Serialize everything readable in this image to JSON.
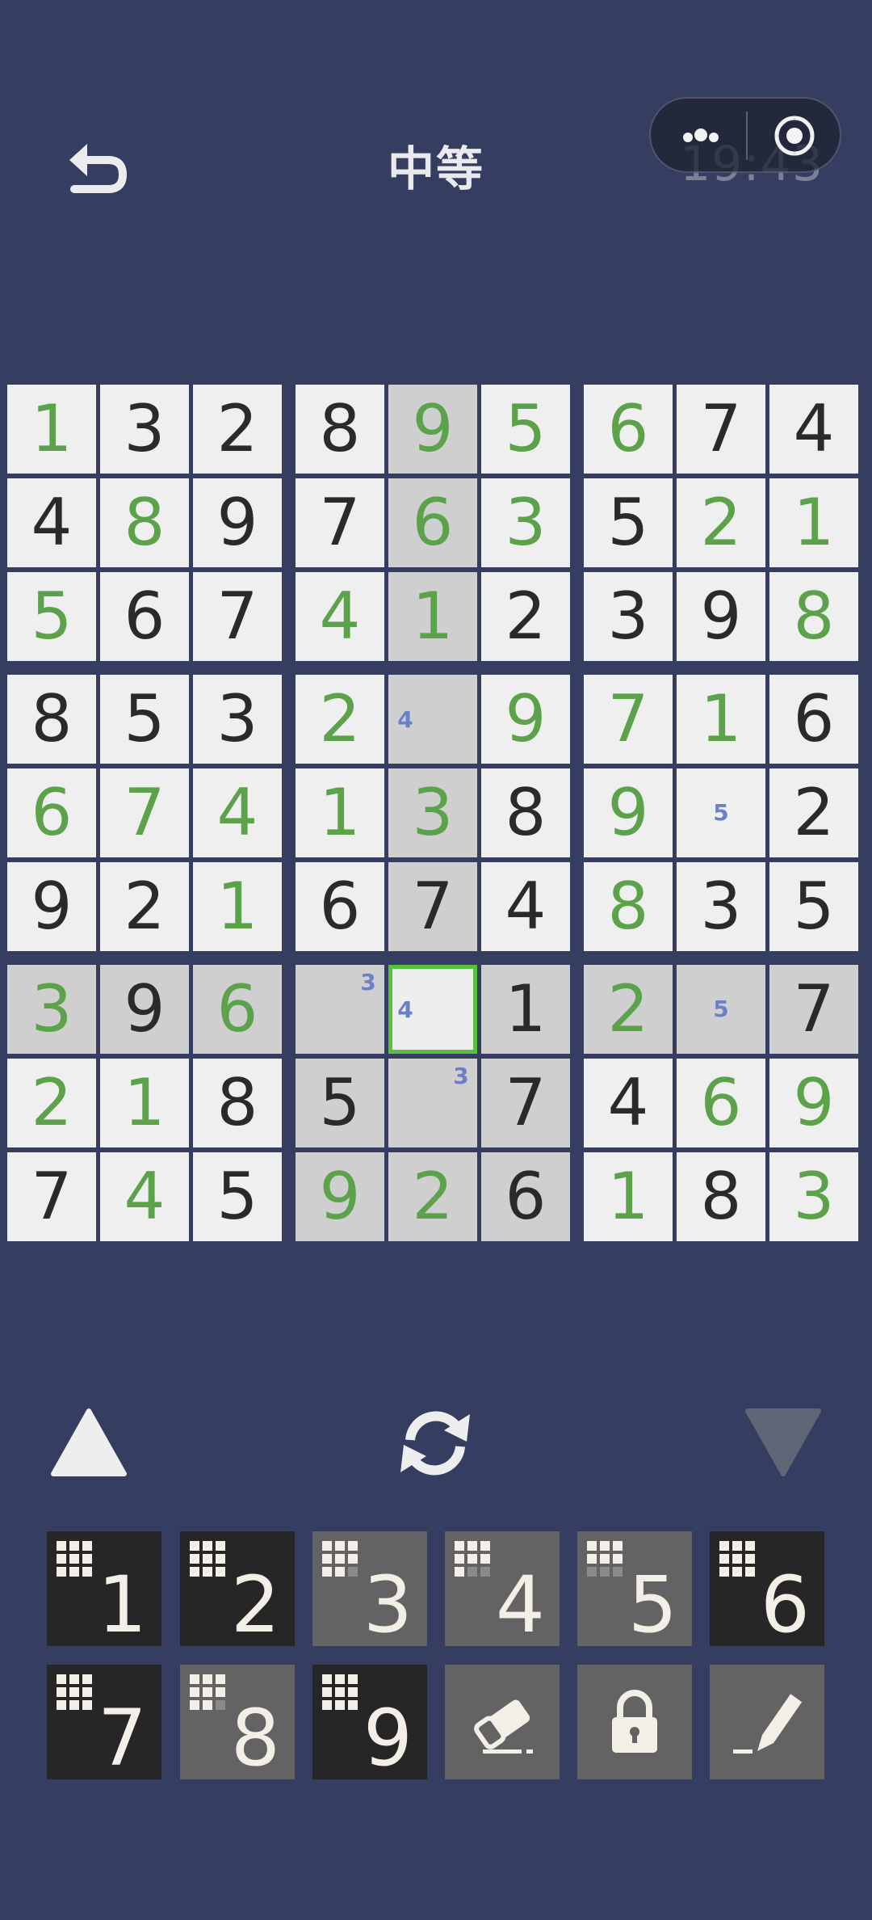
{
  "header": {
    "title": "中等",
    "timer": "19:43"
  },
  "colors": {
    "background": "#353e60",
    "cell": "#efefef",
    "highlight": "#cfcfcf",
    "selected_border": "#57c23d",
    "given_digit": "#2a2a2a",
    "user_digit": "#5ca24a",
    "note_digit": "#6c80c8"
  },
  "board": {
    "rows": [
      [
        "1",
        "3",
        "2",
        "8",
        "9",
        "5",
        "6",
        "7",
        "4"
      ],
      [
        "4",
        "8",
        "9",
        "7",
        "6",
        "3",
        "5",
        "2",
        "1"
      ],
      [
        "5",
        "6",
        "7",
        "4",
        "1",
        "2",
        "3",
        "9",
        "8"
      ],
      [
        "8",
        "5",
        "3",
        "2",
        "",
        "9",
        "7",
        "1",
        "6"
      ],
      [
        "6",
        "7",
        "4",
        "1",
        "3",
        "8",
        "9",
        "",
        "2"
      ],
      [
        "9",
        "2",
        "1",
        "6",
        "7",
        "4",
        "8",
        "3",
        "5"
      ],
      [
        "3",
        "9",
        "6",
        "",
        "",
        "1",
        "2",
        "",
        "7"
      ],
      [
        "2",
        "1",
        "8",
        "5",
        "",
        "7",
        "4",
        "6",
        "9"
      ],
      [
        "7",
        "4",
        "5",
        "9",
        "2",
        "6",
        "1",
        "8",
        "3"
      ]
    ],
    "kinds": [
      [
        "u",
        "g",
        "g",
        "g",
        "u",
        "u",
        "u",
        "g",
        "g"
      ],
      [
        "g",
        "u",
        "g",
        "g",
        "u",
        "u",
        "g",
        "u",
        "u"
      ],
      [
        "u",
        "g",
        "g",
        "u",
        "u",
        "g",
        "g",
        "g",
        "u"
      ],
      [
        "g",
        "g",
        "g",
        "u",
        "",
        "u",
        "u",
        "u",
        "g"
      ],
      [
        "u",
        "u",
        "u",
        "u",
        "u",
        "g",
        "u",
        "",
        "g"
      ],
      [
        "g",
        "g",
        "u",
        "g",
        "g",
        "g",
        "u",
        "g",
        "g"
      ],
      [
        "u",
        "g",
        "u",
        "",
        "",
        "g",
        "u",
        "",
        "g"
      ],
      [
        "u",
        "u",
        "g",
        "g",
        "",
        "g",
        "g",
        "u",
        "u"
      ],
      [
        "g",
        "u",
        "g",
        "u",
        "u",
        "g",
        "u",
        "g",
        "u"
      ]
    ],
    "notes": [
      {
        "row": 3,
        "col": 4,
        "digits": [
          {
            "d": "4",
            "pos": "left"
          }
        ]
      },
      {
        "row": 4,
        "col": 7,
        "digits": [
          {
            "d": "5",
            "pos": "center"
          }
        ]
      },
      {
        "row": 6,
        "col": 3,
        "digits": [
          {
            "d": "3",
            "pos": "top-right"
          }
        ]
      },
      {
        "row": 6,
        "col": 4,
        "digits": [
          {
            "d": "4",
            "pos": "left"
          }
        ]
      },
      {
        "row": 6,
        "col": 7,
        "digits": [
          {
            "d": "5",
            "pos": "center"
          }
        ]
      },
      {
        "row": 7,
        "col": 4,
        "digits": [
          {
            "d": "3",
            "pos": "top-right"
          }
        ]
      }
    ],
    "selected": {
      "row": 6,
      "col": 4
    }
  },
  "controls": {
    "undo_icon": "triangle-up-icon",
    "redo_icon": "triangle-down-icon",
    "refresh_icon": "refresh-icon"
  },
  "keypad": [
    {
      "label": "1",
      "style": "dark",
      "filled": 9
    },
    {
      "label": "2",
      "style": "dark",
      "filled": 9
    },
    {
      "label": "3",
      "style": "gray",
      "filled": 8
    },
    {
      "label": "4",
      "style": "gray",
      "filled": 7
    },
    {
      "label": "5",
      "style": "gray",
      "filled": 6
    },
    {
      "label": "6",
      "style": "dark",
      "filled": 9
    },
    {
      "label": "7",
      "style": "dark",
      "filled": 9
    },
    {
      "label": "8",
      "style": "gray",
      "filled": 8
    },
    {
      "label": "9",
      "style": "dark",
      "filled": 9
    }
  ],
  "tools": [
    {
      "name": "eraser-icon"
    },
    {
      "name": "lock-icon"
    },
    {
      "name": "pencil-icon"
    }
  ]
}
